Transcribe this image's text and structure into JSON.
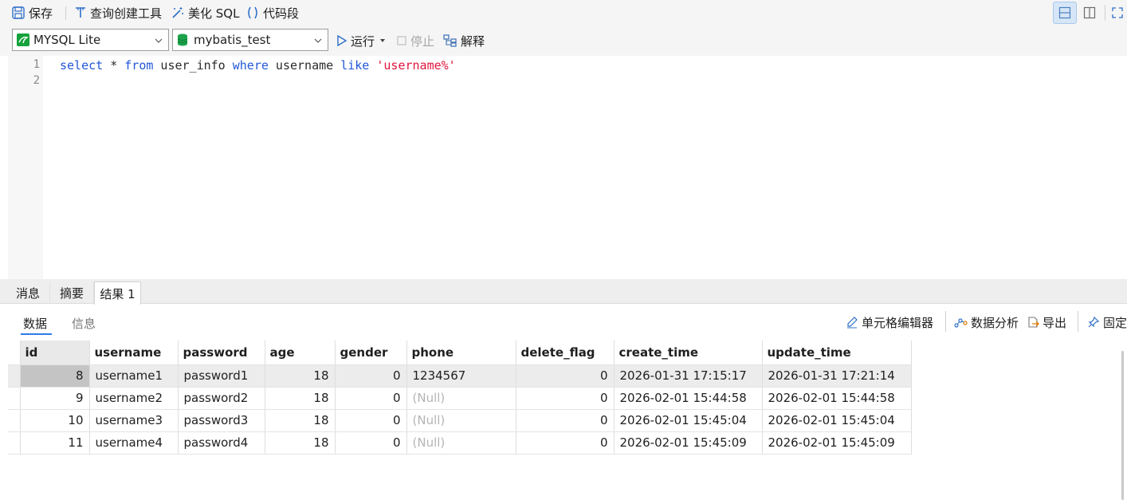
{
  "toolbar": {
    "save": "保存",
    "query_builder": "查询创建工具",
    "beautify_sql": "美化 SQL",
    "code_snippet": "代码段"
  },
  "connection": {
    "name": "MYSQL Lite"
  },
  "database": {
    "name": "mybatis_test"
  },
  "actions": {
    "run": "运行",
    "stop": "停止",
    "explain": "解释"
  },
  "editor": {
    "line_numbers": [
      "1",
      "2"
    ],
    "tokens": {
      "t1": "select",
      "t2": " * ",
      "t3": "from",
      "t4": " user_info ",
      "t5": "where",
      "t6": " username ",
      "t7": "like",
      "t8": " ",
      "t9": "'username%'"
    }
  },
  "result_tabs": [
    "消息",
    "摘要",
    "结果 1"
  ],
  "sub_tabs": [
    "数据",
    "信息"
  ],
  "result_tools": {
    "cell_editor": "单元格编辑器",
    "data_analysis": "数据分析",
    "export": "导出",
    "pin": "固定"
  },
  "grid": {
    "columns": [
      "id",
      "username",
      "password",
      "age",
      "gender",
      "phone",
      "delete_flag",
      "create_time",
      "update_time"
    ],
    "rows": [
      [
        "8",
        "username1",
        "password1",
        "18",
        "0",
        "1234567",
        "0",
        "2026-01-31 17:15:17",
        "2026-01-31 17:21:14"
      ],
      [
        "9",
        "username2",
        "password2",
        "18",
        "0",
        "(Null)",
        "0",
        "2026-02-01 15:44:58",
        "2026-02-01 15:44:58"
      ],
      [
        "10",
        "username3",
        "password3",
        "18",
        "0",
        "(Null)",
        "0",
        "2026-02-01 15:45:04",
        "2026-02-01 15:45:04"
      ],
      [
        "11",
        "username4",
        "password4",
        "18",
        "0",
        "(Null)",
        "0",
        "2026-02-01 15:45:09",
        "2026-02-01 15:45:09"
      ]
    ]
  },
  "colors": {
    "keyword": "#2257d6",
    "string": "#e0153d",
    "null_text": "#b5b5b5",
    "accent": "#2e7be6"
  }
}
